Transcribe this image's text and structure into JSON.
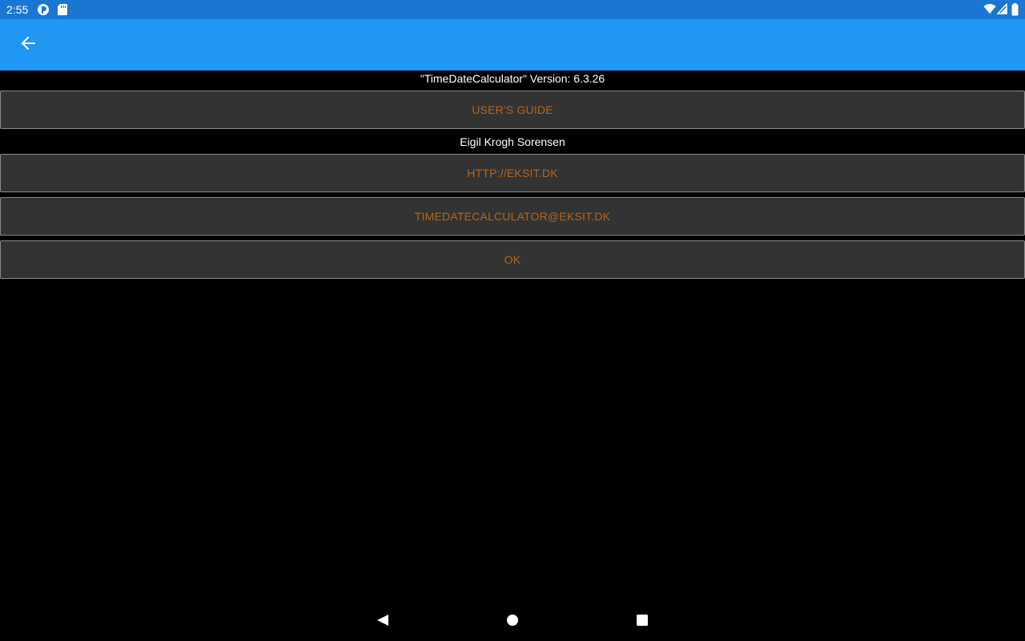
{
  "status_bar": {
    "time": "2:55",
    "left_icons": [
      "pocket-casts-icon",
      "sd-card-icon"
    ],
    "right_icons": [
      "wifi-icon",
      "cell-signal-icon",
      "battery-icon"
    ],
    "background": "#1976D2"
  },
  "app_bar": {
    "back_icon": "arrow-back-icon",
    "background": "#2196F3"
  },
  "about": {
    "version_text": "\"TimeDateCalculator\"  Version: 6.3.26",
    "users_guide_label": "USER'S GUIDE",
    "author": "Eigil Krogh Sorensen",
    "website_label": "HTTP://EKSIT.DK",
    "email_label": "TIMEDATECALCULATOR@EKSIT.DK",
    "ok_label": "OK",
    "button_text_color": "#B5651D"
  },
  "nav_bar": {
    "icons": [
      "back-triangle-icon",
      "home-circle-icon",
      "recents-square-icon"
    ]
  }
}
